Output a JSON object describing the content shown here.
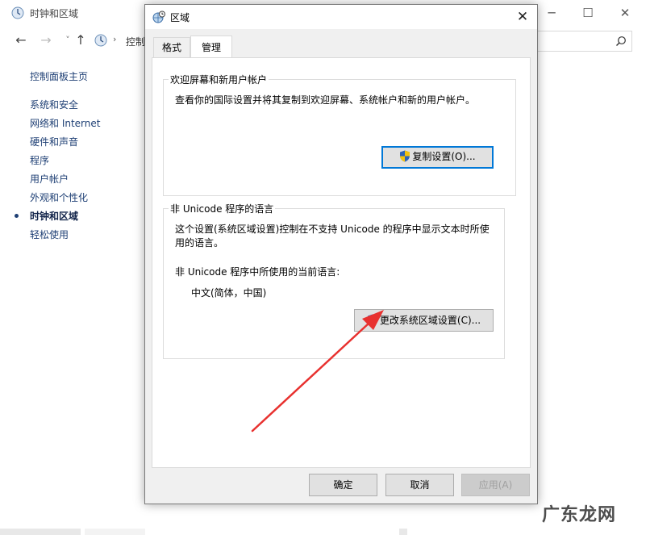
{
  "background_window": {
    "title": "时钟和区域",
    "address_text": "控制",
    "sidebar": {
      "items": [
        {
          "label": "控制面板主页"
        },
        {
          "label": "系统和安全"
        },
        {
          "label": "网络和 Internet"
        },
        {
          "label": "硬件和声音"
        },
        {
          "label": "程序"
        },
        {
          "label": "用户帐户"
        },
        {
          "label": "外观和个性化"
        },
        {
          "label": "时钟和区域",
          "active": true
        },
        {
          "label": "轻松使用"
        }
      ]
    }
  },
  "dialog": {
    "title": "区域",
    "tabs": [
      {
        "label": "格式",
        "selected": false
      },
      {
        "label": "管理",
        "selected": true
      }
    ],
    "welcome_group": {
      "legend": "欢迎屏幕和新用户帐户",
      "description": "查看你的国际设置并将其复制到欢迎屏幕、系统帐户和新的用户帐户。",
      "copy_button": "复制设置(O)..."
    },
    "unicode_group": {
      "legend": "非 Unicode 程序的语言",
      "description": "这个设置(系统区域设置)控制在不支持 Unicode 的程序中显示文本时所使用的语言。",
      "current_label": "非 Unicode 程序中所使用的当前语言:",
      "current_value": "中文(简体，中国)",
      "change_button": "更改系统区域设置(C)..."
    },
    "buttons": {
      "ok": "确定",
      "cancel": "取消",
      "apply": "应用(A)"
    }
  },
  "watermark": "广东龙网",
  "colors": {
    "accent": "#0078d7",
    "arrow": "#e8312f",
    "link": "#1e3f74"
  },
  "icons": [
    "clock-globe-icon",
    "back-arrow-icon",
    "forward-arrow-icon",
    "up-arrow-icon",
    "search-icon",
    "close-icon",
    "minimize-icon",
    "maximize-icon",
    "uac-shield-icon"
  ]
}
